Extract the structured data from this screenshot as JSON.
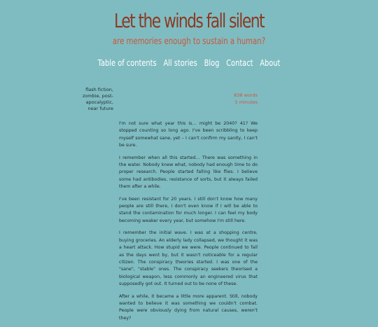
{
  "header": {
    "title": "Let the winds fall silent",
    "tagline": "are memories enough to sustain a human?"
  },
  "nav": {
    "items": [
      {
        "label": "Table of contents"
      },
      {
        "label": "All stories"
      },
      {
        "label": "Blog"
      },
      {
        "label": "Contact"
      },
      {
        "label": "About"
      }
    ]
  },
  "story": {
    "tags": [
      "flash fiction,",
      "zombie, post-",
      "apocalyptic,",
      "near future"
    ],
    "word_count": "838 words",
    "reading_time": "5 minutes",
    "paragraphs": [
      "I'm not sure what year this is… might be 2040? 41? We stopped counting so long ago. I've been scribbling to keep myself somewhat sane, yet – I can't confirm my sanity, I can't be sure.",
      "I remember when all this started… There was something in the water. Nobody knew what, nobody had enough time to do proper research. People started falling like flies. I believe some had antibodies, resistance of sorts, but it always failed them after a while.",
      "I've been resistant for 20 years. I still don't know how many people are still there, I don't even know if I will be able to stand the contamination for much longer. I can feel my body becoming weaker every year, but somehow I'm still here.",
      "I remember the initial wave. I was at a shopping centre, buying groceries. An elderly lady collapsed, we thought it was a heart attack. How stupid we were. People continued to fall as the days went by, but it wasn't noticeable for a regular citizen. The conspiracy theories started. I was one of the \"sane\", \"stable\" ones. The conspiracy seekers theorised a biological weapon, less commonly an engineered virus that supposedly got out. It turned out to be none of these.",
      "After a while, it became a little more apparent. Still, nobody wanted to believe it was something we couldn't combat. People were obviously dying from natural causes, weren't they?"
    ]
  }
}
